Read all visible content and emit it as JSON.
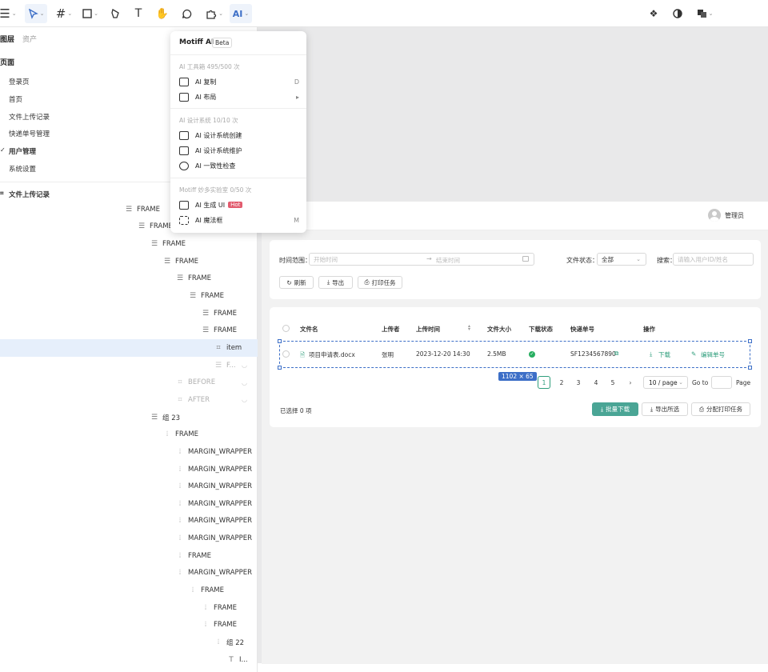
{
  "toolbar": {
    "right_icons": [
      "component-icon",
      "contrast-icon",
      "layers-icon"
    ]
  },
  "left_panel": {
    "tabs": [
      "图层",
      "资产"
    ],
    "pages_heading": "页面",
    "pages": [
      "登录页",
      "首页",
      "文件上传记录",
      "快递单号管理",
      "用户管理",
      "系统设置"
    ],
    "current_frame": "文件上传记录",
    "layers": [
      {
        "label": "FRAME",
        "icon": "frame-icon"
      },
      {
        "label": "FRAME",
        "icon": "frame-icon"
      },
      {
        "label": "FRAME",
        "icon": "frame-icon"
      },
      {
        "label": "FRAME",
        "icon": "frame-icon"
      },
      {
        "label": "FRAME",
        "icon": "frame-icon"
      },
      {
        "label": "FRAME",
        "icon": "frame-icon"
      },
      {
        "label": "FRAME",
        "icon": "frame-icon"
      },
      {
        "label": "FRAME",
        "icon": "frame-icon"
      },
      {
        "label": "item",
        "icon": "hash-icon"
      },
      {
        "label": "F...",
        "icon": "frame-icon"
      },
      {
        "label": "BEFORE",
        "icon": "hash-icon"
      },
      {
        "label": "AFTER",
        "icon": "hash-icon"
      },
      {
        "label": "组 23",
        "icon": "frame-icon"
      },
      {
        "label": "FRAME",
        "icon": "auto-layout-icon"
      },
      {
        "label": "MARGIN_WRAPPER",
        "icon": "auto-layout-icon"
      },
      {
        "label": "MARGIN_WRAPPER",
        "icon": "auto-layout-icon"
      },
      {
        "label": "MARGIN_WRAPPER",
        "icon": "auto-layout-icon"
      },
      {
        "label": "MARGIN_WRAPPER",
        "icon": "auto-layout-icon"
      },
      {
        "label": "MARGIN_WRAPPER",
        "icon": "auto-layout-icon"
      },
      {
        "label": "MARGIN_WRAPPER",
        "icon": "auto-layout-icon"
      },
      {
        "label": "FRAME",
        "icon": "auto-layout-icon"
      },
      {
        "label": "MARGIN_WRAPPER",
        "icon": "auto-layout-icon"
      },
      {
        "label": "FRAME",
        "icon": "auto-layout-icon"
      },
      {
        "label": "FRAME",
        "icon": "auto-layout-icon"
      },
      {
        "label": "FRAME",
        "icon": "auto-layout-icon"
      },
      {
        "label": "组 22",
        "icon": "auto-layout-icon"
      },
      {
        "label": "I...",
        "icon": "text-icon"
      }
    ]
  },
  "ai_menu": {
    "title": "Motiff AI",
    "badge": "Beta",
    "sections": [
      {
        "header": "AI 工具箱  495/500 次",
        "items": [
          {
            "label": "AI 复制",
            "shortcut": "D"
          },
          {
            "label": "AI 布局",
            "shortcut": "▸"
          }
        ]
      },
      {
        "header": "AI 设计系统  10/10 次",
        "items": [
          {
            "label": "AI 设计系统创建"
          },
          {
            "label": "AI 设计系统维护"
          },
          {
            "label": "AI 一致性检查"
          }
        ]
      },
      {
        "header": "Motiff 妙多实验室  0/50 次",
        "items": [
          {
            "label": "AI 生成 UI",
            "tag": "Hot"
          },
          {
            "label": "AI 魔法框",
            "shortcut": "M"
          }
        ]
      }
    ]
  },
  "app": {
    "user": "管理员",
    "filters": {
      "time_label": "时间范围：",
      "start_placeholder": "开始时间",
      "arrow": "→",
      "end_placeholder": "结束时间",
      "status_label": "文件状态：",
      "status_value": "全部",
      "search_label": "搜索：",
      "search_placeholder": "请输入用户ID/姓名",
      "buttons": [
        "刷新",
        "导出",
        "打印任务"
      ]
    },
    "table": {
      "headers": [
        "文件名",
        "上传者",
        "上传时间",
        "文件大小",
        "下载状态",
        "快递单号",
        "操作"
      ],
      "rows": [
        {
          "file": "项目申请表.docx",
          "uploader": "张明",
          "time": "2023-12-20 14:30",
          "size": "2.5MB",
          "tracking": "SF1234567890",
          "actions": [
            "下载",
            "编辑单号"
          ]
        }
      ]
    },
    "selection_size": "1102 × 65",
    "pagination": {
      "pages": [
        "1",
        "2",
        "3",
        "4",
        "5"
      ],
      "current": "1",
      "next": "›",
      "per_page": "10 / page",
      "goto_label": "Go to",
      "page_suffix": "Page"
    },
    "footer": {
      "selected_text": "已选择 0 项",
      "buttons": [
        "批量下载",
        "导出所选",
        "分配打印任务"
      ]
    }
  }
}
